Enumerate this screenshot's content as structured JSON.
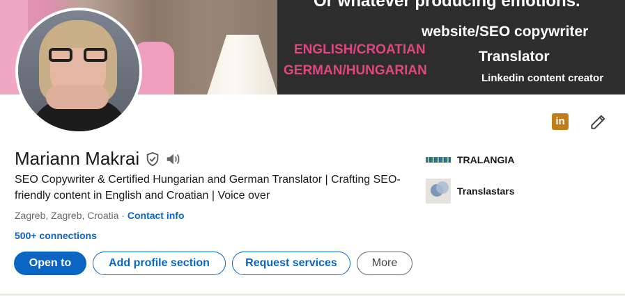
{
  "banner": {
    "line_top": "Or  whatever producing emotions.",
    "line_seo": "website/SEO copywriter",
    "line_english": "ENGLISH/CROATIAN",
    "line_german": "GERMAN/HUNGARIAN",
    "line_translator": "Translator",
    "line_linkedin": "Linkedin content creator"
  },
  "profile": {
    "name": "Mariann Makrai",
    "headline": "SEO Copywriter & Certified Hungarian and German Translator | Crafting SEO-friendly content in English and Croatian | Voice over",
    "location": "Zagreb, Zagreb, Croatia",
    "separator": " · ",
    "contact_label": "Contact info",
    "connections": "500+ connections"
  },
  "icons": {
    "linkedin_badge": "in",
    "verified": "shield-check-icon",
    "pronunciation": "speaker-icon",
    "edit": "pencil-icon"
  },
  "companies": [
    {
      "name": "TRALANGIA"
    },
    {
      "name": "Translastars"
    }
  ],
  "actions": {
    "open_to": "Open to",
    "add_section": "Add profile section",
    "request_services": "Request services",
    "more": "More"
  },
  "colors": {
    "primary": "#0a66c2",
    "linkedin_badge": "#c37d16",
    "banner_pink": "#e0477f"
  }
}
